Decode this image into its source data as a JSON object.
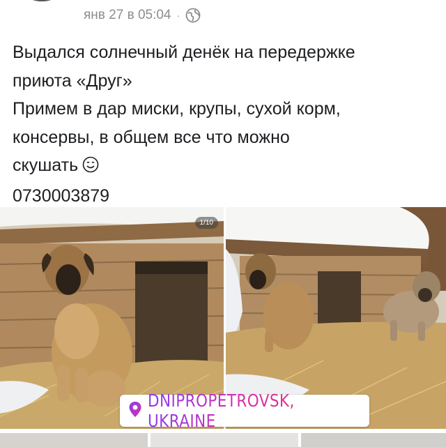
{
  "post": {
    "timestamp": "янв 27 в 05:04",
    "separator": "·",
    "privacy_icon": "globe-icon",
    "text_lines": [
      "Выдался солнечный денёк на передержке",
      "приюта «Друг»",
      "Примем в дар миски, крупы, сухой корм,",
      "консервы, в общем все что можно",
      "скушать"
    ],
    "emoji": "smile-emoji",
    "phone": "0730003879"
  },
  "gallery": {
    "counter": "1/10",
    "location": "DNIPROPETROVSK, UKRAINE",
    "location_icon": "map-pin-icon",
    "location_gradient": [
      "#8b3cf0",
      "#d72fa9",
      "#e23a6b"
    ]
  }
}
